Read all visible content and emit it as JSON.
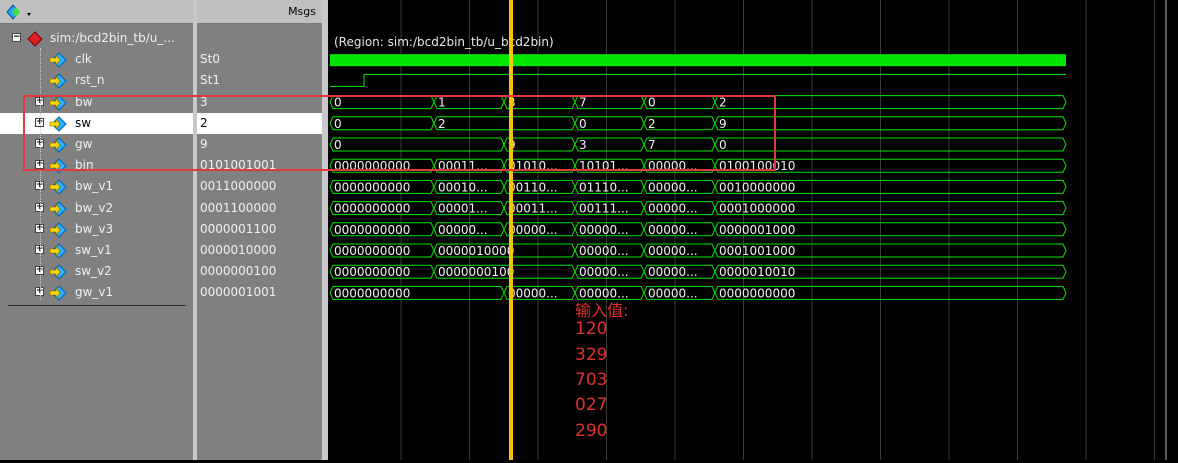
{
  "header": {
    "msgs": "Msgs"
  },
  "region": "(Region: sim:/bcd2bin_tb/u_bcd2bin)",
  "signals": [
    {
      "name": "sim:/bcd2bin_tb/u_...",
      "value": "",
      "kind": "root"
    },
    {
      "name": "clk",
      "value": "St0",
      "kind": "bit"
    },
    {
      "name": "rst_n",
      "value": "St1",
      "kind": "bit"
    },
    {
      "name": "bw",
      "value": "3",
      "kind": "bus"
    },
    {
      "name": "sw",
      "value": "2",
      "kind": "bus",
      "selected": true
    },
    {
      "name": "gw",
      "value": "9",
      "kind": "bus"
    },
    {
      "name": "bin",
      "value": "0101001001",
      "kind": "bus"
    },
    {
      "name": "bw_v1",
      "value": "0011000000",
      "kind": "bus"
    },
    {
      "name": "bw_v2",
      "value": "0001100000",
      "kind": "bus"
    },
    {
      "name": "bw_v3",
      "value": "0000001100",
      "kind": "bus"
    },
    {
      "name": "sw_v1",
      "value": "0000010000",
      "kind": "bus"
    },
    {
      "name": "sw_v2",
      "value": "0000000100",
      "kind": "bus"
    },
    {
      "name": "gw_v1",
      "value": "0000001001",
      "kind": "bus"
    }
  ],
  "bus_waves": {
    "bw": [
      "0",
      "1",
      "3",
      "7",
      "0",
      "2"
    ],
    "sw": [
      "0",
      "2",
      "",
      "0",
      "2",
      "9"
    ],
    "gw": [
      "0",
      "",
      "9",
      "3",
      "7",
      "0"
    ],
    "bin": [
      "0000000000",
      "00011...",
      "01010...",
      "10101...",
      "00000...",
      "0100100010"
    ],
    "bw_v1": [
      "0000000000",
      "00010...",
      "00110...",
      "01110...",
      "00000...",
      "0010000000"
    ],
    "bw_v2": [
      "0000000000",
      "00001...",
      "00011...",
      "00111...",
      "00000...",
      "0001000000"
    ],
    "bw_v3": [
      "0000000000",
      "00000...",
      "00000...",
      "00000...",
      "00000...",
      "0000001000"
    ],
    "sw_v1": [
      "0000000000",
      "0000010000",
      "",
      "00000...",
      "00000...",
      "0001001000"
    ],
    "sw_v2": [
      "0000000000",
      "0000000100",
      "",
      "00000...",
      "00000...",
      "0000010010"
    ],
    "gw_v1": [
      "0000000000",
      "",
      "00000...",
      "00000...",
      "00000...",
      "0000000000"
    ]
  },
  "notes": {
    "title": "输入值:",
    "values": [
      "120",
      "329",
      "703",
      "027",
      "290"
    ]
  },
  "colors": {
    "wave": "#00e600",
    "cursor": "#f5c400",
    "highlight_box": "#e03a3a",
    "note_text": "#e03030"
  }
}
